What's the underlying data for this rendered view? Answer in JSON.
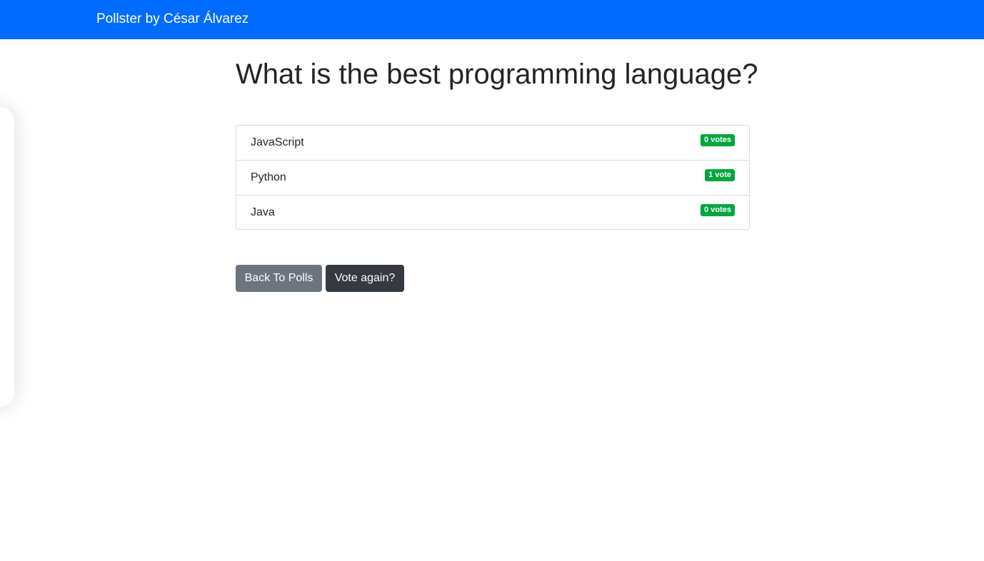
{
  "navbar": {
    "brand": "Pollster by César Álvarez",
    "color": "#006cff"
  },
  "poll": {
    "question": "What is the best programming language?",
    "choices": [
      {
        "label": "JavaScript",
        "votes": "0 votes"
      },
      {
        "label": "Python",
        "votes": "1 vote"
      },
      {
        "label": "Java",
        "votes": "0 votes"
      }
    ],
    "badge_color": "#00a63e"
  },
  "actions": {
    "back_label": "Back To Polls",
    "vote_again_label": "Vote again?"
  }
}
